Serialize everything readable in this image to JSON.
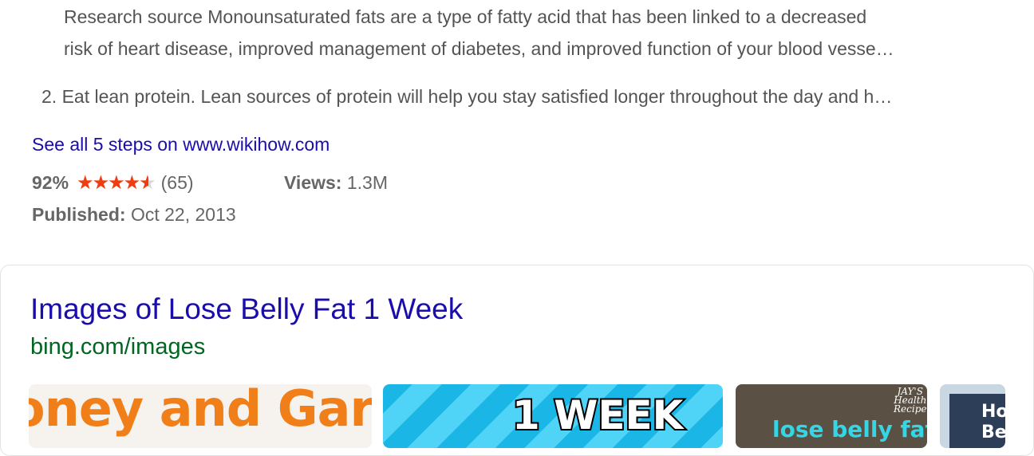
{
  "steps": {
    "line1": "Research source Monounsaturated fats are a type of fatty acid that has been linked to a decreased",
    "line2": "risk of heart disease, improved management of diabetes, and improved function of your blood vesse…",
    "step2": "2. Eat lean protein. Lean sources of protein will help you stay satisfied longer throughout the day and h…"
  },
  "see_all_link": "See all 5 steps on www.wikihow.com",
  "rating": {
    "percent_label": "92%",
    "percent_value": 0.92,
    "stars_glyphs": "★★★★★",
    "count": "(65)",
    "star_color": "#f03c0e"
  },
  "views": {
    "label": "Views:",
    "value": "1.3M"
  },
  "published": {
    "label": "Published:",
    "value": "Oct 22, 2013"
  },
  "images_section": {
    "title": "Images of Lose Belly Fat 1 Week",
    "url": "bing.com/images",
    "thumbnails": [
      {
        "text": "oney and Garl"
      },
      {
        "text": "1 WEEK"
      },
      {
        "text": "lose belly fat",
        "logo_line1": "JAY'S",
        "logo_line2": "Health",
        "logo_line3": "Recipe"
      },
      {
        "text_line1": "Ho",
        "text_line2": "Be"
      }
    ]
  },
  "colors": {
    "link": "#1a0dab",
    "url": "#006621",
    "snippet": "#545454"
  }
}
